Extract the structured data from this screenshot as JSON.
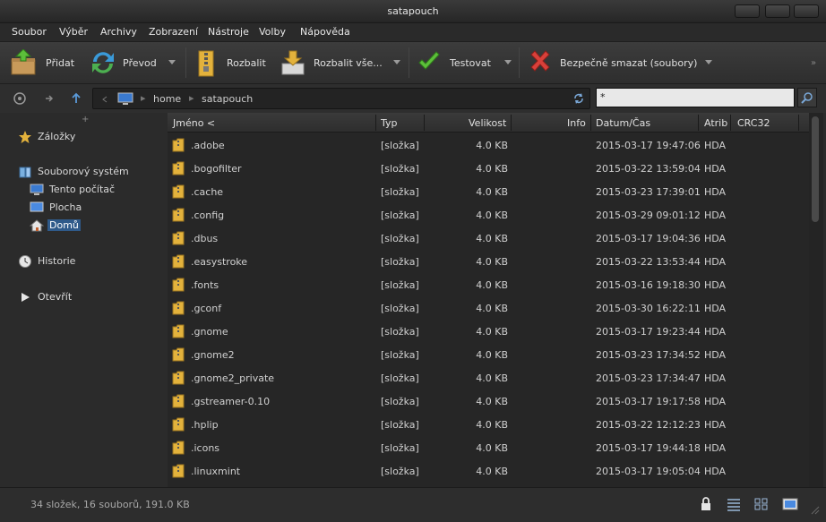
{
  "window": {
    "title": "satapouch"
  },
  "menu": [
    "Soubor",
    "Výběr",
    "Archivy",
    "Zobrazení",
    "Nástroje",
    "Volby",
    "Nápověda"
  ],
  "toolbar": {
    "add": "Přidat",
    "convert": "Převod",
    "extract": "Rozbalit",
    "extract_all": "Rozbalit vše...",
    "test": "Testovat",
    "secure_delete": "Bezpečně smazat (soubory)"
  },
  "address": {
    "crumbs": [
      "home",
      "satapouch"
    ],
    "filter_value": "*"
  },
  "sidebar": {
    "bookmarks": "Záložky",
    "filesystem": "Souborový systém",
    "computer": "Tento počítač",
    "desktop": "Plocha",
    "home": "Domů",
    "history": "Historie",
    "open": "Otevřít"
  },
  "columns": {
    "name": "Jméno <",
    "type": "Typ",
    "size": "Velikost",
    "info": "Info",
    "date": "Datum/Čas",
    "attr": "Atrib",
    "crc": "CRC32"
  },
  "rows": [
    {
      "name": ".adobe",
      "type": "[složka]",
      "size": "4.0 KB",
      "date": "2015-03-17 19:47:06",
      "attr": "HDA"
    },
    {
      "name": ".bogofilter",
      "type": "[složka]",
      "size": "4.0 KB",
      "date": "2015-03-22 13:59:04",
      "attr": "HDA"
    },
    {
      "name": ".cache",
      "type": "[složka]",
      "size": "4.0 KB",
      "date": "2015-03-23 17:39:01",
      "attr": "HDA"
    },
    {
      "name": ".config",
      "type": "[složka]",
      "size": "4.0 KB",
      "date": "2015-03-29 09:01:12",
      "attr": "HDA"
    },
    {
      "name": ".dbus",
      "type": "[složka]",
      "size": "4.0 KB",
      "date": "2015-03-17 19:04:36",
      "attr": "HDA"
    },
    {
      "name": ".easystroke",
      "type": "[složka]",
      "size": "4.0 KB",
      "date": "2015-03-22 13:53:44",
      "attr": "HDA"
    },
    {
      "name": ".fonts",
      "type": "[složka]",
      "size": "4.0 KB",
      "date": "2015-03-16 19:18:30",
      "attr": "HDA"
    },
    {
      "name": ".gconf",
      "type": "[složka]",
      "size": "4.0 KB",
      "date": "2015-03-30 16:22:11",
      "attr": "HDA"
    },
    {
      "name": ".gnome",
      "type": "[složka]",
      "size": "4.0 KB",
      "date": "2015-03-17 19:23:44",
      "attr": "HDA"
    },
    {
      "name": ".gnome2",
      "type": "[složka]",
      "size": "4.0 KB",
      "date": "2015-03-23 17:34:52",
      "attr": "HDA"
    },
    {
      "name": ".gnome2_private",
      "type": "[složka]",
      "size": "4.0 KB",
      "date": "2015-03-23 17:34:47",
      "attr": "HDA"
    },
    {
      "name": ".gstreamer-0.10",
      "type": "[složka]",
      "size": "4.0 KB",
      "date": "2015-03-17 19:17:58",
      "attr": "HDA"
    },
    {
      "name": ".hplip",
      "type": "[složka]",
      "size": "4.0 KB",
      "date": "2015-03-22 12:12:23",
      "attr": "HDA"
    },
    {
      "name": ".icons",
      "type": "[složka]",
      "size": "4.0 KB",
      "date": "2015-03-17 19:44:18",
      "attr": "HDA"
    },
    {
      "name": ".linuxmint",
      "type": "[složka]",
      "size": "4.0 KB",
      "date": "2015-03-17 19:05:04",
      "attr": "HDA"
    }
  ],
  "status": {
    "text": "34 složek, 16 souborů, 191.0 KB"
  },
  "colors": {
    "accent": "#2f5a8a",
    "folder": "#e3b23c",
    "background": "#2b2b2b"
  }
}
